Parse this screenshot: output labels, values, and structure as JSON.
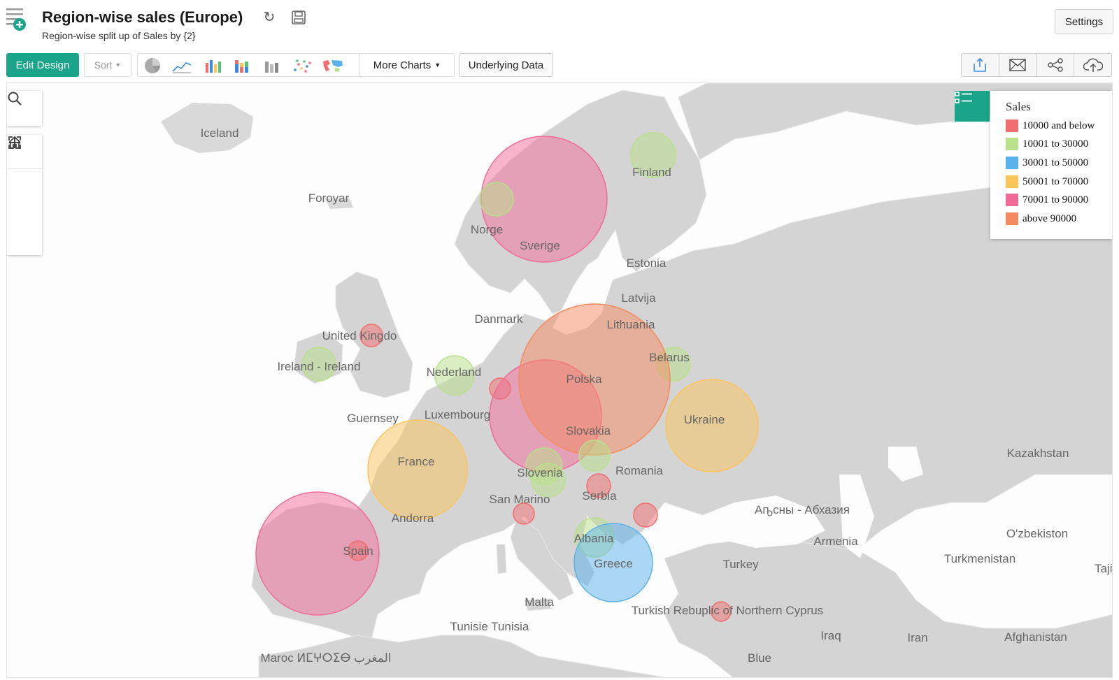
{
  "header": {
    "title": "Region-wise sales (Europe)",
    "subtitle": "Region-wise split up of Sales by {2}",
    "settings_label": "Settings"
  },
  "toolbar": {
    "edit_design": "Edit Design",
    "sort": "Sort",
    "more_charts": "More Charts",
    "underlying_data": "Underlying Data"
  },
  "legend": {
    "title": "Sales",
    "items": [
      {
        "label": "10000 and below",
        "color": "#f26d6d"
      },
      {
        "label": "10001 to 30000",
        "color": "#b9e08a"
      },
      {
        "label": "30001 to 50000",
        "color": "#5bb1ec"
      },
      {
        "label": "50001 to 70000",
        "color": "#fcc45a"
      },
      {
        "label": "70001 to 90000",
        "color": "#f16b98"
      },
      {
        "label": "above 90000",
        "color": "#f58a5e"
      }
    ]
  },
  "map_labels": {
    "iceland": "Iceland",
    "foroyar": "Foroyar",
    "norge": "Norge",
    "sverige": "Sverige",
    "finland": "Finland",
    "estonia": "Estonia",
    "latvija": "Latvija",
    "lithuania": "Lithuania",
    "danmark": "Danmark",
    "united_kingdom": "United Kingdo",
    "ireland": "Ireland - Ireland",
    "nederland": "Nederland",
    "belarus": "Belarus",
    "polska": "Polska",
    "guernsey": "Guernsey",
    "luxembourg": "Luxembourg",
    "slovakia": "Slovakia",
    "ukraine": "Ukraine",
    "france": "France",
    "kazakhstan": "Kazakhstan",
    "romania": "Romania",
    "slovenia": "Slovenia",
    "san_marino": "San Marino",
    "serbia": "Serbia",
    "andorra": "Andorra",
    "abkhazia": "Аҧсны - Абхазия",
    "armenia": "Armenia",
    "uzbekistan": "O'zbekiston",
    "albania": "Albania",
    "spain": "Spain",
    "greece": "Greece",
    "turkey": "Turkey",
    "turkmenistan": "Turkmenistan",
    "tajik": "Tajik",
    "malta": "Malta",
    "northern_cyprus": "Turkish Rebuplic of Northern Cyprus",
    "tunisia": "Tunisie Tunisia",
    "iraq": "Iraq",
    "iran": "Iran",
    "afghanistan": "Afghanistan",
    "maroc": "Maroc ⵍⵎⵖⵔⵉⴱ المغرب",
    "blue": "Blue"
  }
}
